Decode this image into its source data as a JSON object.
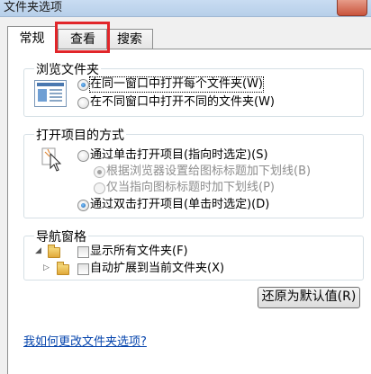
{
  "window": {
    "title": "文件夹选项"
  },
  "tabs": [
    {
      "label": "常规"
    },
    {
      "label": "查看"
    },
    {
      "label": "搜索"
    }
  ],
  "browse_folders": {
    "title": "浏览文件夹",
    "options": [
      {
        "label": "在同一窗口中打开每个文件夹(W)",
        "checked": true
      },
      {
        "label": "在不同窗口中打开不同的文件夹(W)",
        "checked": false
      }
    ]
  },
  "click_items": {
    "title": "打开项目的方式",
    "single_click": {
      "label": "通过单击打开项目(指向时选定)(S)",
      "checked": false
    },
    "sub_options": [
      {
        "label": "根据浏览器设置给图标标题加下划线(B)",
        "checked": true,
        "disabled": true
      },
      {
        "label": "仅当指向图标标题时加下划线(P)",
        "checked": false,
        "disabled": true
      }
    ],
    "double_click": {
      "label": "通过双击打开项目(单击时选定)(D)",
      "checked": true
    }
  },
  "navigation_pane": {
    "title": "导航窗格",
    "options": [
      {
        "label": "显示所有文件夹(F)",
        "checked": false
      },
      {
        "label": "自动扩展到当前文件夹(X)",
        "checked": false
      }
    ]
  },
  "restore_button": {
    "label": "还原为默认值(R)"
  },
  "help_link": {
    "label": "我如何更改文件夹选项?"
  },
  "icons": {
    "browse": "window-layout-icon",
    "click": "cursor-click-icon",
    "tree_expand": "tree-expand-icon",
    "folder": "folder-icon"
  },
  "colors": {
    "highlight_box": "#e1262a",
    "link": "#0645ad"
  }
}
